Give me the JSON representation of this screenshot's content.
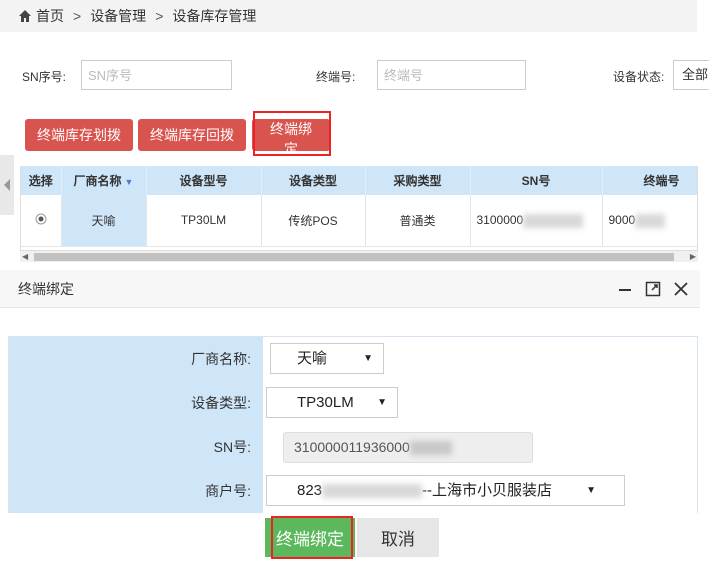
{
  "breadcrumb": {
    "home": "首页",
    "level2": "设备管理",
    "level3": "设备库存管理",
    "separator": ">"
  },
  "filters": {
    "sn_label": "SN序号:",
    "sn_placeholder": "SN序号",
    "terminal_label": "终端号:",
    "terminal_placeholder": "终端号",
    "status_label": "设备状态:",
    "status_value": "全部"
  },
  "toolbar": {
    "transfer_label": "终端库存划拨",
    "return_label": "终端库存回拨",
    "bind_label": "终端绑定"
  },
  "table": {
    "headers": [
      "选择",
      "厂商名称",
      "设备型号",
      "设备类型",
      "采购类型",
      "SN号",
      "终端号"
    ],
    "rows": [
      {
        "vendor": "天喻",
        "model": "TP30LM",
        "type": "传统POS",
        "purchase": "普通类",
        "sn": "3100000",
        "terminal": "9000"
      }
    ]
  },
  "dialog": {
    "title": "终端绑定",
    "fields": {
      "vendor_label": "厂商名称:",
      "vendor_value": "天喻",
      "type_label": "设备类型:",
      "type_value": "TP30LM",
      "sn_label": "SN号:",
      "sn_value": "310000011936000",
      "merchant_label": "商户号:",
      "merchant_prefix": "823",
      "merchant_suffix": "--上海市小贝服装店"
    },
    "confirm_label": "终端绑定",
    "cancel_label": "取消"
  },
  "colors": {
    "accent_red": "#d9534f",
    "header_blue": "#cfe6f8",
    "confirm_green": "#5cb85c",
    "highlight": "#e22222"
  }
}
